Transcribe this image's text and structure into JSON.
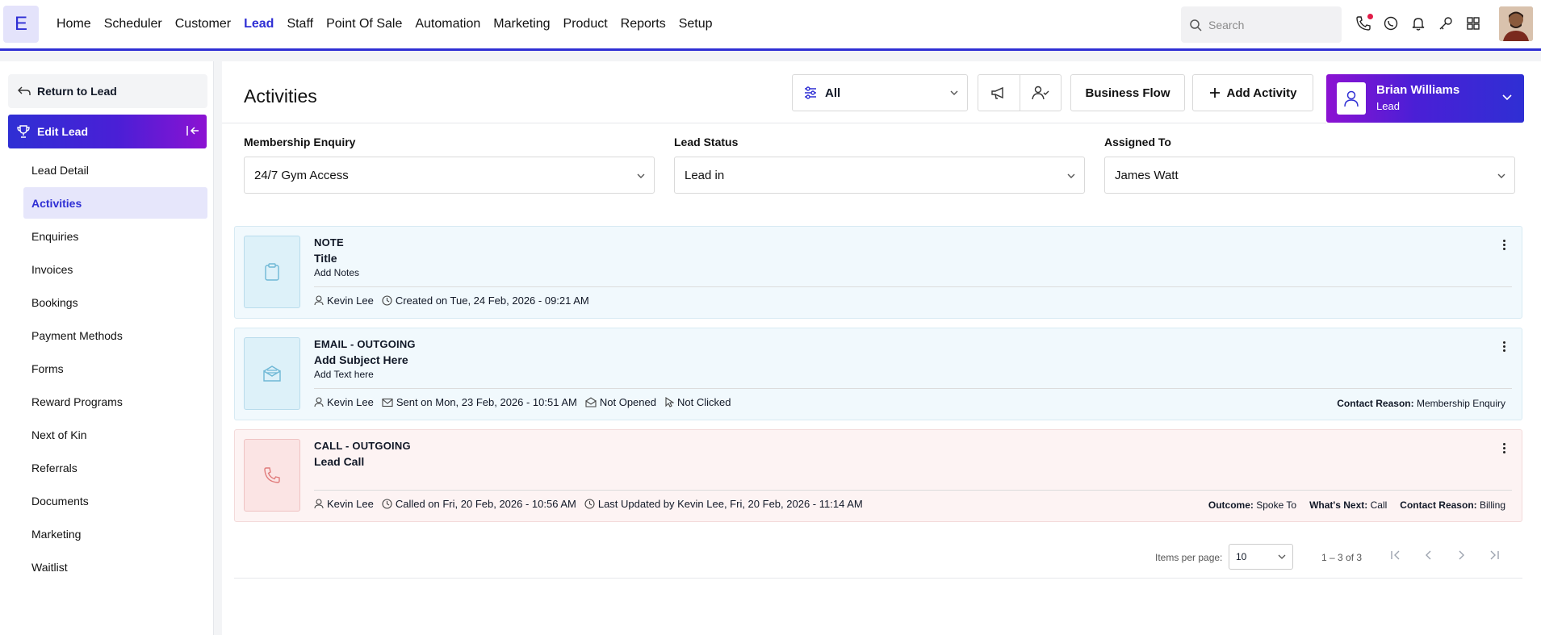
{
  "topnav": {
    "logo_letter": "E",
    "items": [
      "Home",
      "Scheduler",
      "Customer",
      "Lead",
      "Staff",
      "Point Of Sale",
      "Automation",
      "Marketing",
      "Product",
      "Reports",
      "Setup"
    ],
    "active": "Lead",
    "search_placeholder": "Search",
    "icons": [
      "phone-icon",
      "whatsapp-icon",
      "bell-icon",
      "key-icon",
      "apps-grid-icon"
    ]
  },
  "sidebar": {
    "return_label": "Return to Lead",
    "edit_label": "Edit Lead",
    "items": [
      "Lead Detail",
      "Activities",
      "Enquiries",
      "Invoices",
      "Bookings",
      "Payment Methods",
      "Forms",
      "Reward Programs",
      "Next of Kin",
      "Referrals",
      "Documents",
      "Marketing",
      "Waitlist"
    ],
    "active": "Activities"
  },
  "header": {
    "title": "Activities",
    "filter_value": "All",
    "business_flow_label": "Business Flow",
    "add_activity_label": "Add Activity",
    "person_name": "Brian Williams",
    "person_role": "Lead"
  },
  "fields": {
    "membership": {
      "label": "Membership Enquiry",
      "value": "24/7 Gym Access"
    },
    "status": {
      "label": "Lead Status",
      "value": "Lead in"
    },
    "assigned": {
      "label": "Assigned To",
      "value": "James Watt"
    }
  },
  "activities": [
    {
      "type": "NOTE",
      "title": "Title",
      "subtitle": "Add Notes",
      "user": "Kevin Lee",
      "meta1": "Created on Tue, 24 Feb, 2026 - 09:21 AM"
    },
    {
      "type": "EMAIL - OUTGOING",
      "title": "Add Subject Here",
      "subtitle": "Add Text here",
      "user": "Kevin Lee",
      "meta1": "Sent on Mon, 23 Feb, 2026 - 10:51 AM",
      "meta2": "Not Opened",
      "meta3": "Not Clicked",
      "right": [
        {
          "k": "Contact Reason:",
          "v": "Membership Enquiry"
        }
      ]
    },
    {
      "type": "CALL - OUTGOING",
      "title": "Lead Call",
      "user": "Kevin Lee",
      "meta1": "Called on Fri, 20 Feb, 2026 - 10:56 AM",
      "meta2": "Last Updated by Kevin Lee, Fri, 20 Feb, 2026 - 11:14 AM",
      "right": [
        {
          "k": "Outcome:",
          "v": "Spoke To"
        },
        {
          "k": "What's Next:",
          "v": "Call"
        },
        {
          "k": "Contact Reason:",
          "v": "Billing"
        }
      ]
    }
  ],
  "pagination": {
    "label": "Items per page:",
    "per_page": "10",
    "range": "1 – 3 of 3"
  },
  "colors": {
    "brand": "#2f2fd4",
    "accent_purple": "#8c12d2",
    "note_bg": "#f1f9fd",
    "call_bg": "#fdf3f3"
  }
}
